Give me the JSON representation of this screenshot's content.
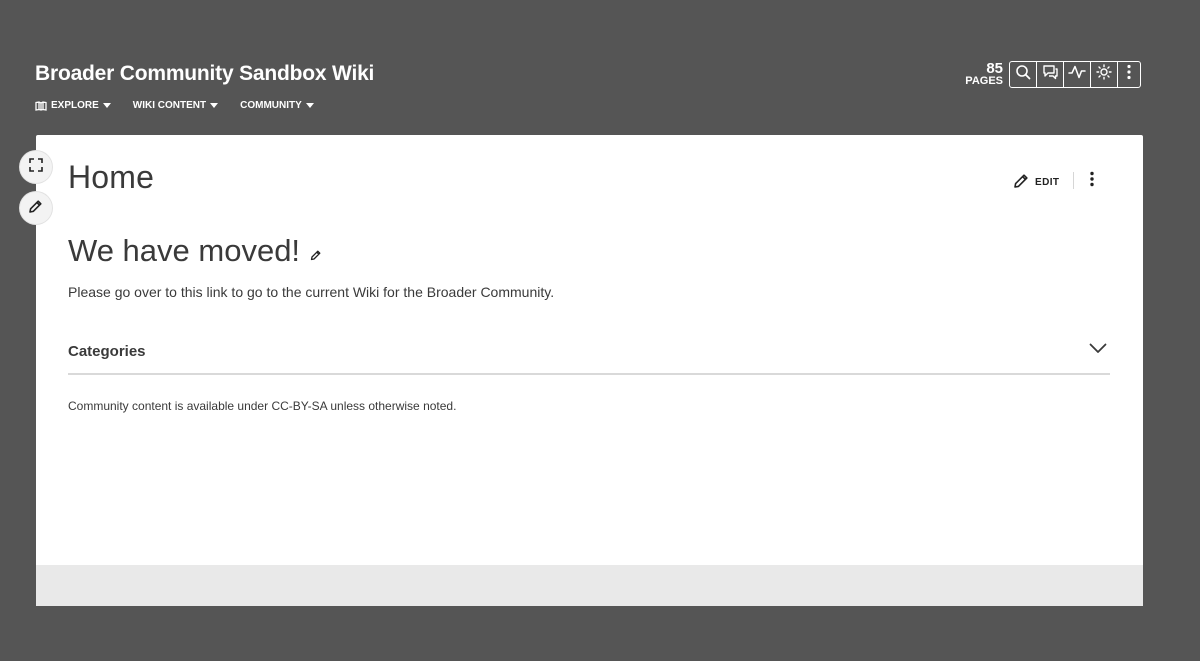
{
  "header": {
    "wiki_title": "Broader Community Sandbox Wiki",
    "nav": [
      {
        "label": "EXPLORE",
        "icon": "explore-icon"
      },
      {
        "label": "WIKI CONTENT"
      },
      {
        "label": "COMMUNITY"
      }
    ],
    "pages_count": "85",
    "pages_label": "PAGES",
    "toolbox_icons": [
      "search-icon",
      "discussions-icon",
      "activity-icon",
      "theme-toggle-icon",
      "more-vertical-icon"
    ]
  },
  "article": {
    "title": "Home",
    "edit_label": "EDIT",
    "heading": "We have moved!",
    "paragraph": {
      "before": "Please go over to ",
      "link": "this link",
      "after": " to go to the current Wiki for the Broader Community."
    },
    "categories_label": "Categories",
    "license": {
      "before": "Community content is available under ",
      "link": "CC-BY-SA",
      "after": " unless otherwise noted."
    }
  },
  "colors": {
    "background": "#555555",
    "content_bg": "#ffffff",
    "text": "#3a3a3a",
    "footer_bg": "#e9e9e9"
  }
}
